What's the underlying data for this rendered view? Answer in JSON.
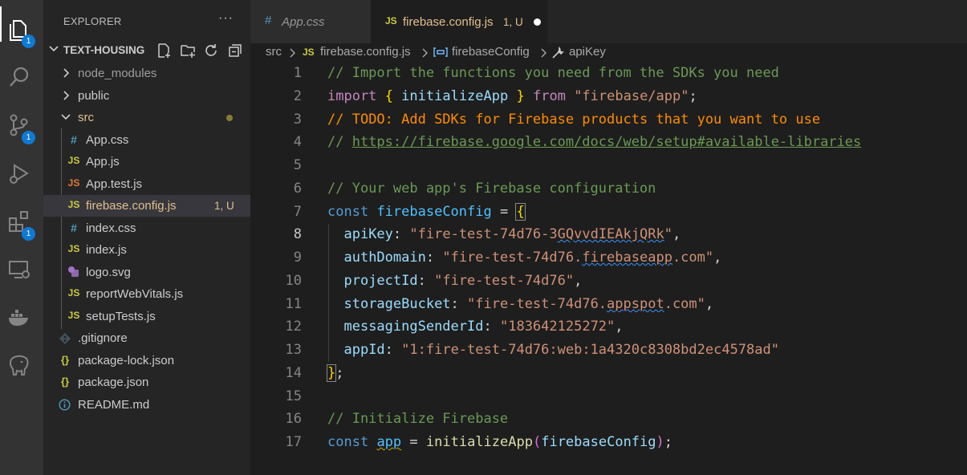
{
  "activity_bar": {
    "badges": {
      "explorer": "1",
      "source_control": "1",
      "extensions": "1"
    }
  },
  "sidebar": {
    "title": "EXPLORER",
    "more": "···",
    "project": "TEXT-HOUSING",
    "items": [
      {
        "label": "node_modules",
        "type": "folder",
        "icon": "chevron-right-icon"
      },
      {
        "label": "public",
        "type": "folder",
        "icon": "chevron-right-icon"
      },
      {
        "label": "src",
        "type": "folder",
        "icon": "chevron-down-icon"
      },
      {
        "label": "App.css",
        "type": "css",
        "icon": "#"
      },
      {
        "label": "App.js",
        "type": "js",
        "icon": "JS"
      },
      {
        "label": "App.test.js",
        "type": "js",
        "icon": "JS"
      },
      {
        "label": "firebase.config.js",
        "type": "js",
        "icon": "JS",
        "status": "1, U"
      },
      {
        "label": "index.css",
        "type": "css",
        "icon": "#"
      },
      {
        "label": "index.js",
        "type": "js",
        "icon": "JS"
      },
      {
        "label": "logo.svg",
        "type": "svg",
        "icon": "svg-icon"
      },
      {
        "label": "reportWebVitals.js",
        "type": "js",
        "icon": "JS"
      },
      {
        "label": "setupTests.js",
        "type": "js",
        "icon": "JS"
      },
      {
        "label": ".gitignore",
        "type": "git",
        "icon": "gitignore-icon"
      },
      {
        "label": "package-lock.json",
        "type": "json",
        "icon": "{}"
      },
      {
        "label": "package.json",
        "type": "json",
        "icon": "{}"
      },
      {
        "label": "README.md",
        "type": "md",
        "icon": "info-icon"
      }
    ]
  },
  "tabs": [
    {
      "icon": "#",
      "label": "App.css"
    },
    {
      "icon": "JS",
      "label": "firebase.config.js",
      "status": "1, U"
    }
  ],
  "breadcrumb": {
    "segments": [
      "src",
      "firebase.config.js",
      "firebaseConfig",
      "apiKey"
    ],
    "js_icon": "JS"
  },
  "editor": {
    "line_numbers": [
      "1",
      "2",
      "3",
      "4",
      "5",
      "6",
      "7",
      "8",
      "9",
      "10",
      "11",
      "12",
      "13",
      "14",
      "15",
      "16",
      "17"
    ],
    "current_line": "8",
    "tokens": {
      "l1": "// Import the functions you need from the SDKs you need",
      "l2_import": "import",
      "l2_brace_open": "{",
      "l2_fn": "initializeApp",
      "l2_brace_close": "}",
      "l2_from": "from",
      "l2_str": "\"firebase/app\"",
      "l2_semi": ";",
      "l3_slashes": "// ",
      "l3_todo": "TODO: Add SDKs for Firebase products that you want to use",
      "l4_slashes": "// ",
      "l4_link": "https://firebase.google.com/docs/web/setup#available-libraries",
      "l6": "// Your web app's Firebase configuration",
      "l7_const": "const",
      "l7_name": "firebaseConfig",
      "l7_eq": "=",
      "l7_brace": "{",
      "l8_key": "apiKey",
      "l8_val_a": "\"fire-test-74d76-3",
      "l8_val_b": "GQvvdIEAkjQRk",
      "l8_val_c": "\"",
      "l9_key": "authDomain",
      "l9_val_a": "\"fire-test-74d76.",
      "l9_val_b": "firebaseapp",
      "l9_val_c": ".com\"",
      "l10_key": "projectId",
      "l10_val": "\"fire-test-74d76\"",
      "l11_key": "storageBucket",
      "l11_val_a": "\"fire-test-74d76.",
      "l11_val_b": "appspot",
      "l11_val_c": ".com\"",
      "l12_key": "messagingSenderId",
      "l12_val": "\"183642125272\"",
      "l13_key": "appId",
      "l13_val": "\"1:fire-test-74d76:web:1a4320c8308bd2ec4578ad\"",
      "l14_brace": "}",
      "l14_semi": ";",
      "l16": "// Initialize Firebase",
      "l17_const": "const",
      "l17_name": "app",
      "l17_eq": "=",
      "l17_fn": "initializeApp",
      "l17_paren_open": "(",
      "l17_arg": "firebaseConfig",
      "l17_paren_close": ")",
      "l17_semi": ";",
      "colon": ":",
      "comma": ","
    }
  },
  "colors": {
    "js_icon": "#cbcb41",
    "css_icon": "#519aba",
    "modified": "#e2c08d",
    "badge": "#0e7ad3"
  }
}
